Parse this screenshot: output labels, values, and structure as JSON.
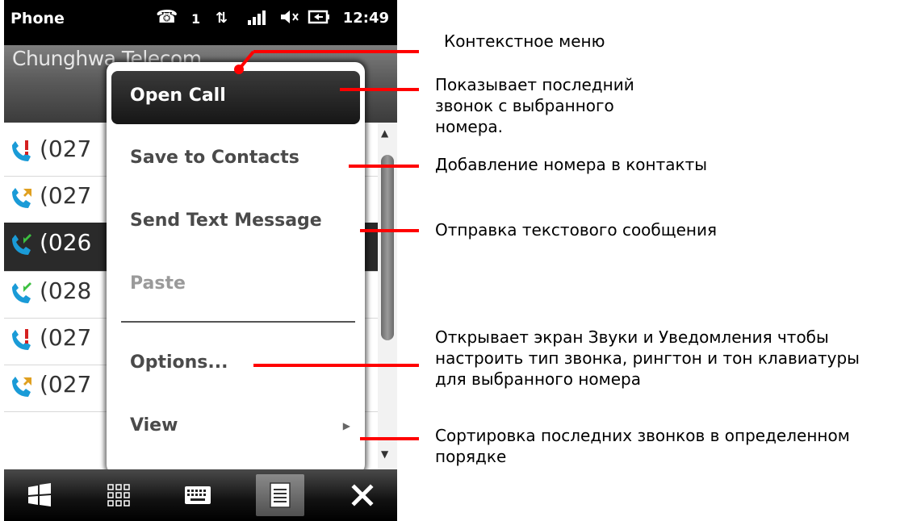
{
  "status_bar": {
    "app_title": "Phone",
    "line_number": "1",
    "time": "12:49"
  },
  "carrier": "Chunghwa Telecom",
  "call_list": {
    "rows": [
      {
        "number": "(027",
        "icon": "missed-call-icon",
        "selected": false
      },
      {
        "number": "(027",
        "icon": "outgoing-call-icon",
        "selected": false
      },
      {
        "number": "(026",
        "icon": "incoming-call-icon",
        "selected": true
      },
      {
        "number": "(028",
        "icon": "incoming-call-icon",
        "selected": false
      },
      {
        "number": "(027",
        "icon": "missed-call-icon",
        "selected": false
      },
      {
        "number": "(027",
        "icon": "outgoing-call-icon",
        "selected": false
      }
    ]
  },
  "context_menu": {
    "items": [
      {
        "label": "Open Call",
        "state": "highlighted"
      },
      {
        "label": "Save to Contacts",
        "state": "normal"
      },
      {
        "label": "Send Text Message",
        "state": "normal"
      },
      {
        "label": "Paste",
        "state": "disabled"
      },
      {
        "label": "Options...",
        "state": "normal"
      },
      {
        "label": "View",
        "state": "normal",
        "submenu": true
      }
    ]
  },
  "taskbar": {
    "buttons": [
      "windows-start-icon",
      "keypad-icon",
      "keyboard-icon",
      "menu-icon",
      "close-icon"
    ],
    "active": "menu-icon"
  },
  "annotations": [
    {
      "text": "Контекстное меню"
    },
    {
      "text": "Показывает последний звонок с выбранного номера."
    },
    {
      "text": "Добавление номера в контакты"
    },
    {
      "text": "Отправка текстового сообщения"
    },
    {
      "text": "Открывает экран Звуки и Уведомления чтобы настроить тип звонка, рингтон и тон клавиатуры для выбранного номера"
    },
    {
      "text": "Сортировка последних звонков в определенном порядке"
    }
  ],
  "colors": {
    "annotation_line": "#ff0000",
    "incoming_call_icon": "#1a9bd7",
    "missed_call_icon": "#d42020"
  }
}
